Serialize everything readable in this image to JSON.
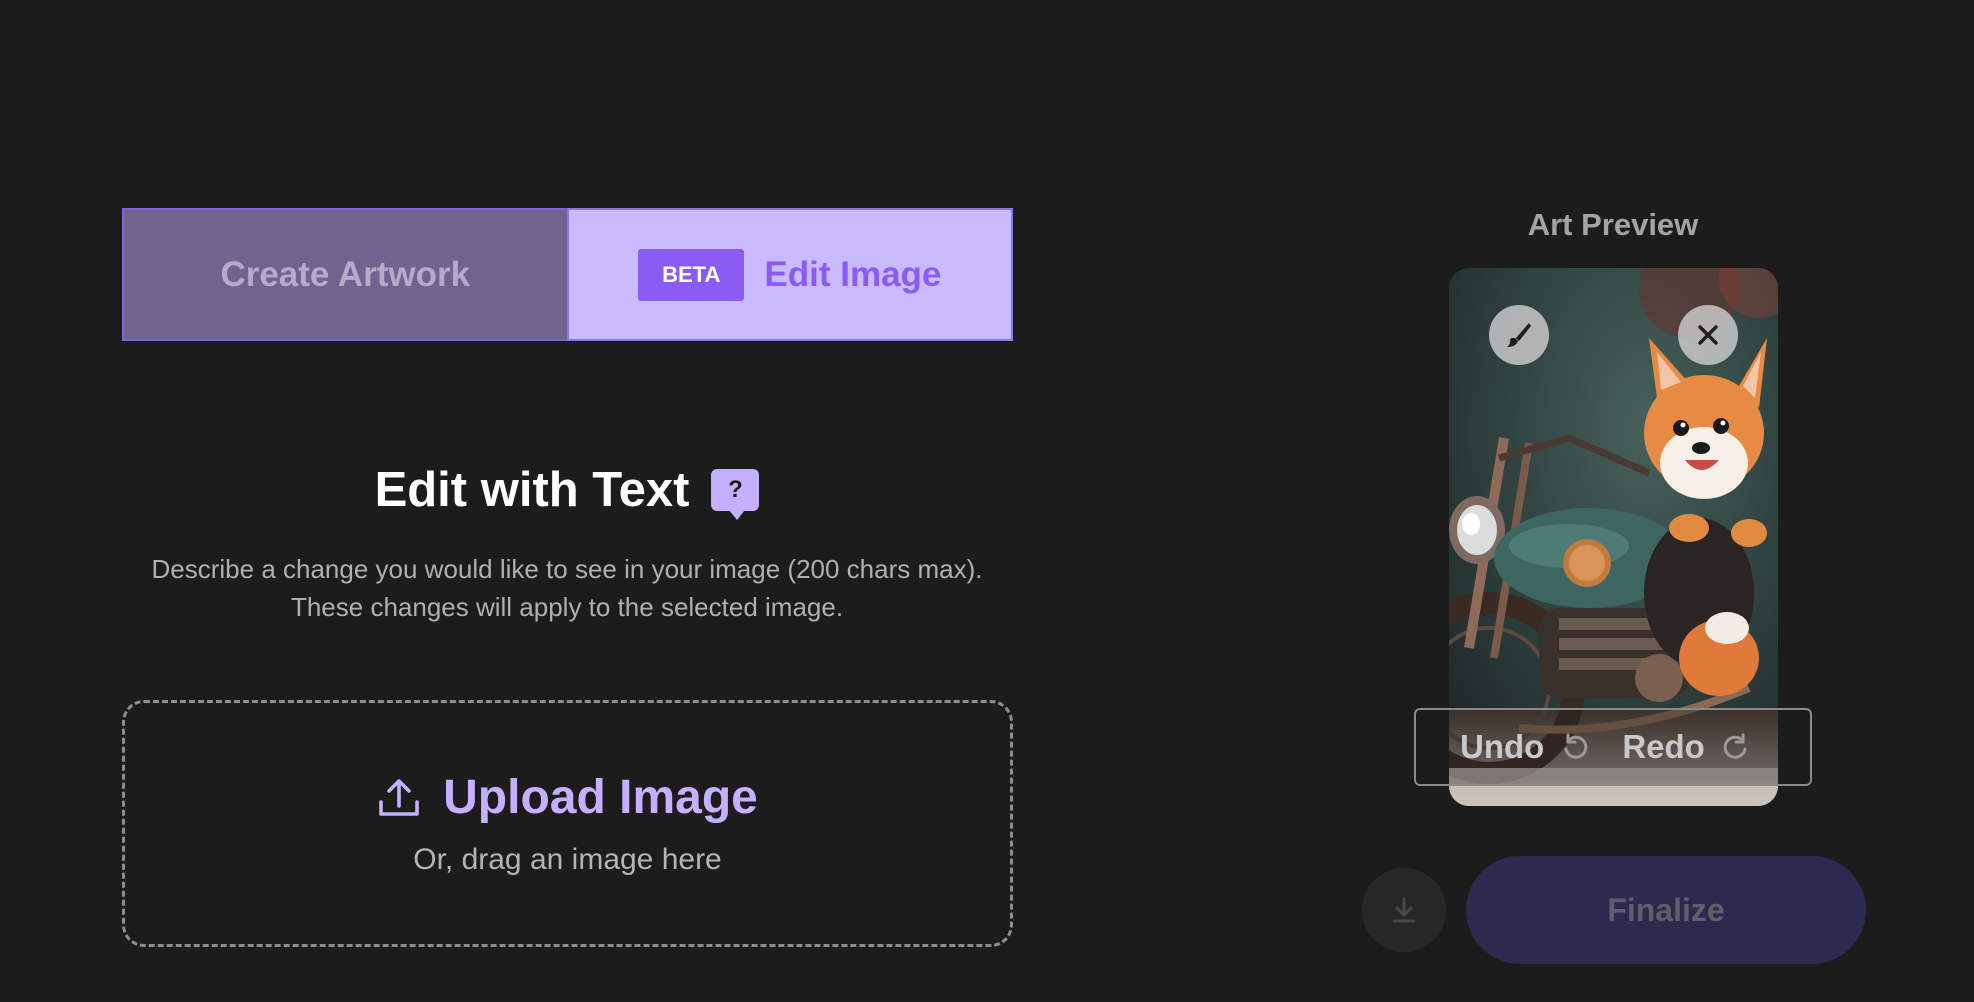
{
  "tabs": {
    "create_label": "Create Artwork",
    "beta_badge": "BETA",
    "edit_label": "Edit Image"
  },
  "edit_section": {
    "title": "Edit with Text",
    "help_glyph": "?",
    "description": "Describe a change you would like to see in your image (200 chars max). These changes will apply to the selected image."
  },
  "upload": {
    "label": "Upload Image",
    "sub_label": "Or, drag an image here",
    "icon": "upload-icon"
  },
  "preview": {
    "label": "Art Preview",
    "brush_icon": "brush-icon",
    "close_icon": "close-icon"
  },
  "history": {
    "undo_label": "Undo",
    "redo_label": "Redo"
  },
  "actions": {
    "finalize_label": "Finalize",
    "download_icon": "download-icon"
  },
  "colors": {
    "accent": "#8a5cf4",
    "accent_light": "#c4b0ff",
    "background": "#1c1c1c"
  }
}
